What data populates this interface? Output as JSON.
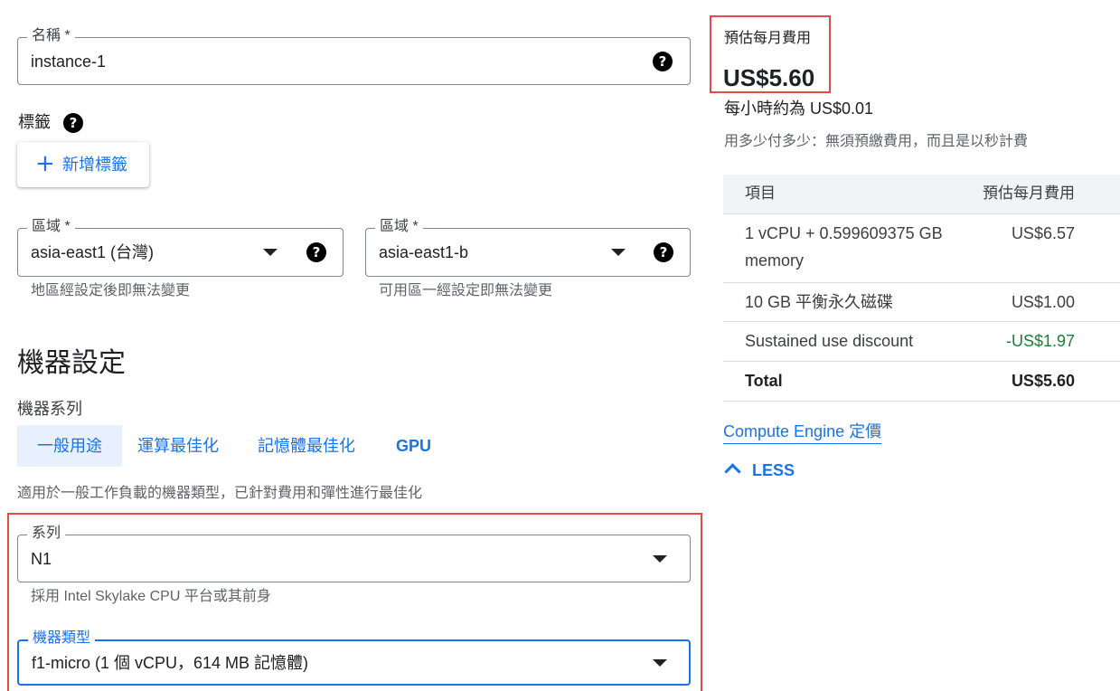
{
  "name_field": {
    "label": "名稱 *",
    "value": "instance-1"
  },
  "labels_section": {
    "title": "標籤",
    "add_button": "新增標籤"
  },
  "region_field": {
    "label": "區域 *",
    "value": "asia-east1 (台灣)",
    "hint": "地區經設定後即無法變更"
  },
  "zone_field": {
    "label": "區域 *",
    "value": "asia-east1-b",
    "hint": "可用區一經設定即無法變更"
  },
  "machine_config": {
    "heading": "機器設定",
    "series_heading": "機器系列",
    "tabs": [
      {
        "label": "一般用途",
        "active": true
      },
      {
        "label": "運算最佳化",
        "active": false
      },
      {
        "label": "記憶體最佳化",
        "active": false
      },
      {
        "label": "GPU",
        "active": false
      }
    ],
    "description": "適用於一般工作負載的機器類型，已針對費用和彈性進行最佳化",
    "series_field": {
      "label": "系列",
      "value": "N1",
      "hint": "採用 Intel Skylake CPU 平台或其前身"
    },
    "type_field": {
      "label": "機器類型",
      "value": "f1-micro (1 個 vCPU，614 MB 記憶體)"
    }
  },
  "pricing": {
    "title": "預估每月費用",
    "amount": "US$5.60",
    "hourly": "每小時約為 US$0.01",
    "note": "用多少付多少：無須預繳費用，而且是以秒計費",
    "table": {
      "headers": [
        "項目",
        "預估每月費用"
      ],
      "rows": [
        {
          "item": "1 vCPU + 0.599609375 GB memory",
          "cost": "US$6.57"
        },
        {
          "item": "10 GB 平衡永久磁碟",
          "cost": "US$1.00"
        },
        {
          "item": "Sustained use discount",
          "cost": "-US$1.97"
        },
        {
          "item": "Total",
          "cost": "US$5.60"
        }
      ]
    },
    "link": "Compute Engine 定價",
    "less_button": "LESS"
  },
  "colors": {
    "accent": "#1a73e8",
    "discount": "#188038",
    "highlight": "#e84a4a"
  }
}
